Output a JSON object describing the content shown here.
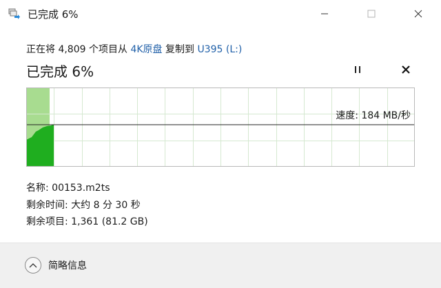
{
  "window": {
    "title": "已完成 6%"
  },
  "summary": {
    "prefix": "正在将 4,809 个项目从",
    "source": "4K原盘",
    "middle": "复制到",
    "destination": "U395 (L:)"
  },
  "progress": {
    "heading": "已完成 6%",
    "percent": 6,
    "speed_label": "速度: 184 MB/秒"
  },
  "details": {
    "name_label": "名称:",
    "name_value": "00153.m2ts",
    "time_label": "剩余时间:",
    "time_value": "大约 8 分 30 秒",
    "items_label": "剩余项目:",
    "items_value": "1,361 (81.2 GB)"
  },
  "footer": {
    "toggle_label": "简略信息"
  },
  "colors": {
    "graph_fill": "#1fae1f",
    "graph_progress_bg": "#a8dc90",
    "graph_grid": "#d5e8d0",
    "graph_border": "#b8b8b8",
    "link": "#1f5fa8"
  },
  "icons": {
    "app": "copy-arrow-icon",
    "minimize": "minimize-icon",
    "maximize": "maximize-icon",
    "close": "close-icon",
    "pause": "pause-icon",
    "cancel": "cancel-icon",
    "toggle": "chevron-up-icon"
  }
}
